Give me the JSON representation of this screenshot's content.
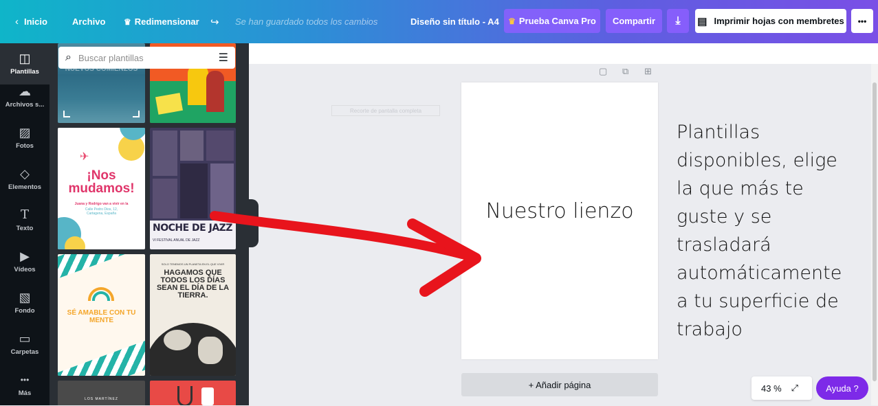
{
  "topbar": {
    "back_label": "Inicio",
    "file_label": "Archivo",
    "resize_label": "Redimensionar",
    "saved_status": "Se han guardado todos los cambios",
    "design_title": "Diseño sin título - A4",
    "pro_label": "Prueba Canva Pro",
    "share_label": "Compartir",
    "print_label": "Imprimir hojas con membretes",
    "more_label": "•••"
  },
  "rail": {
    "items": [
      {
        "label": "Plantillas",
        "icon": "template-icon",
        "glyph": "▣"
      },
      {
        "label": "Archivos s...",
        "icon": "cloud-upload-icon",
        "glyph": "☁"
      },
      {
        "label": "Fotos",
        "icon": "photo-icon",
        "glyph": "▨"
      },
      {
        "label": "Elementos",
        "icon": "shapes-icon",
        "glyph": "◇"
      },
      {
        "label": "Texto",
        "icon": "text-icon",
        "glyph": "T"
      },
      {
        "label": "Vídeos",
        "icon": "video-icon",
        "glyph": "▶"
      },
      {
        "label": "Fondo",
        "icon": "background-icon",
        "glyph": "▧"
      },
      {
        "label": "Carpetas",
        "icon": "folder-icon",
        "glyph": "▭"
      },
      {
        "label": "Más",
        "icon": "more-icon",
        "glyph": "•••"
      }
    ]
  },
  "panel": {
    "search_placeholder": "Buscar plantillas",
    "templates": {
      "t1": "NUEVOS COMIENZOS",
      "t3_title": "¡Nos mudamos!",
      "t3_sub": "Juana y Rodrigo van a vivir en la",
      "t3_addr": "Calle Pedro Dios, 12, Cartagena, España",
      "t4_title": "NOCHE DE JAZZ",
      "t4_sub": "VI FESTIVAL ANUAL DE JAZZ",
      "t5_title": "SÉ AMABLE CON TU MENTE",
      "t6_title": "HAGAMOS QUE TODOS LOS DÍAS SEAN EL DÍA DE LA TIERRA.",
      "t6_top": "SOLO TENEMOS UN PLANETA EN EL QUE VIVIR",
      "t7": "LOS MARTÍNEZ"
    }
  },
  "workspace": {
    "ghost_text": "Recorte de pantalla completa",
    "page_text": "Nuestro lienzo",
    "add_page_label": "+ Añadir página",
    "annotation": "Plantillas disponibles, elige la que más te guste y se trasladará automáticamente a tu superficie de trabajo",
    "zoom_value": "43 %",
    "help_label": "Ayuda ?"
  },
  "colors": {
    "accent": "#7d2ae8",
    "arrow": "#e8141c",
    "rail_bg": "#0e1318",
    "panel_bg": "#2a2f35"
  }
}
